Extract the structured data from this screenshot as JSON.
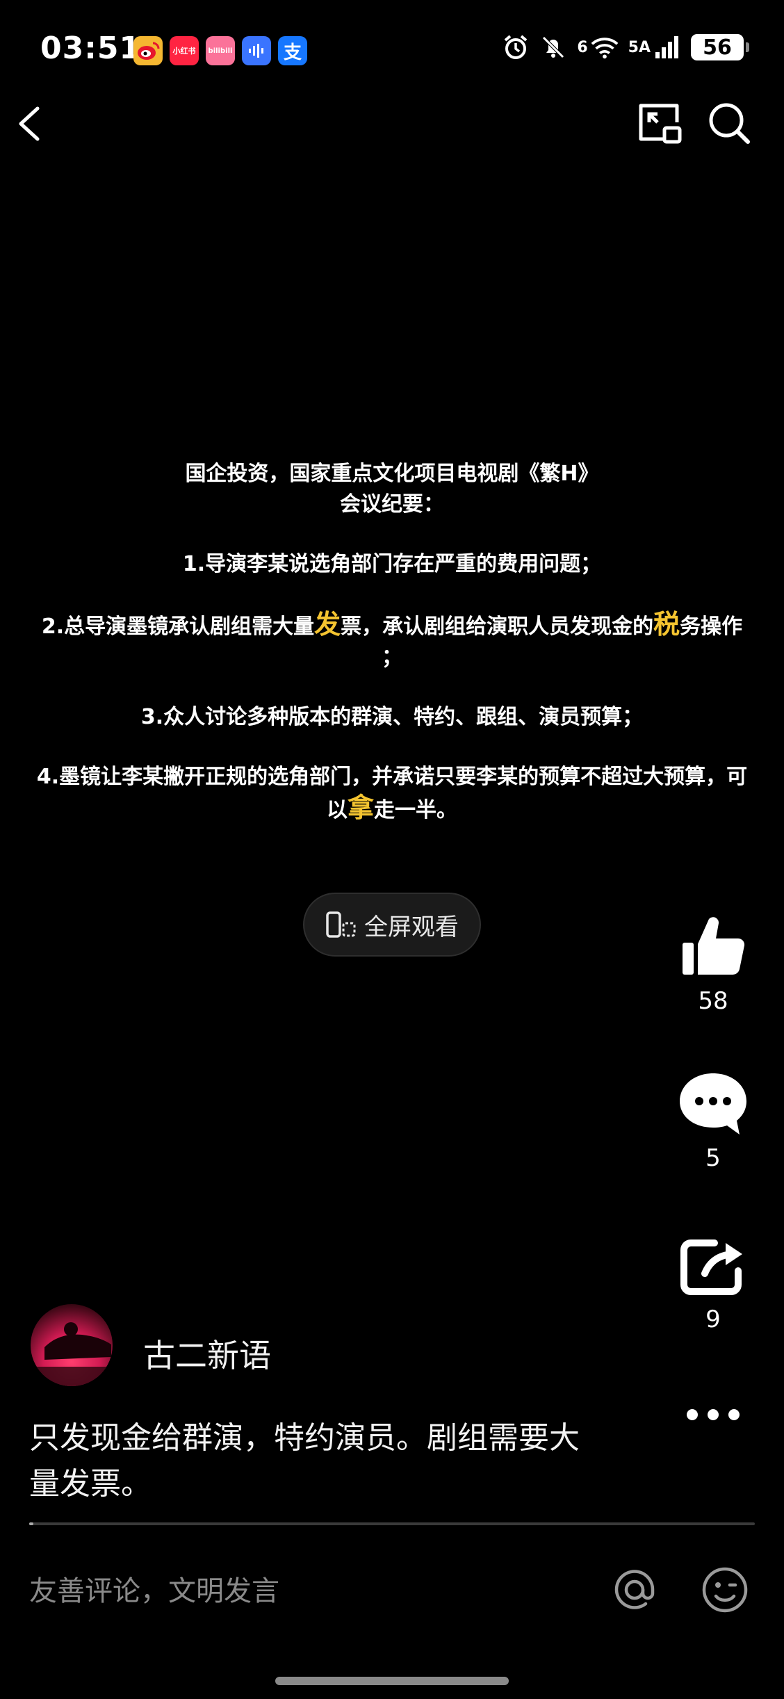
{
  "status_bar": {
    "time": "03:51",
    "apps": [
      {
        "name": "weibo-icon",
        "label": "",
        "color": "#f5b731"
      },
      {
        "name": "xiaohongshu-icon",
        "label": "小红书",
        "color": "#ff2442"
      },
      {
        "name": "bilibili-icon",
        "label": "bilibili",
        "color": "#fb7299"
      },
      {
        "name": "voice-app-icon",
        "label": "",
        "color": "#3a74ff"
      },
      {
        "name": "alipay-icon",
        "label": "支",
        "color": "#1677ff"
      }
    ],
    "net_label_1": "6",
    "net_label_2": "5A",
    "battery": "56"
  },
  "video": {
    "title_line1": "国企投资，国家重点文化项目电视剧《繁H》",
    "title_line2": "会议纪要：",
    "point1": "1.导演李某说选角部门存在严重的费用问题；",
    "point2_a": "2.总导演墨镜承认剧组需大量",
    "point2_h1": "发",
    "point2_b": "票，承认剧组给演职人员发现金的",
    "point2_h2": "税",
    "point2_c": "务操作",
    "point2_end": "；",
    "point3": "3.众人讨论多种版本的群演、特约、跟组、演员预算；",
    "point4_line1": "4.墨镜让李某撇开正规的选角部门，并承诺只要李某的预算不超过大预算，可",
    "point4_a": "以",
    "point4_h": "拿",
    "point4_b": "走一半。",
    "highlight_color": "#f4c430"
  },
  "fullscreen_label": "全屏观看",
  "actions": {
    "like_count": "58",
    "comment_count": "5",
    "share_count": "9"
  },
  "author": {
    "name": "古二新语"
  },
  "caption_line1": "只发现金给群演，特约演员。剧组需要大",
  "caption_line2": "量发票。",
  "progress": 0.004,
  "comment_bar": {
    "placeholder": "友善评论，文明发言"
  }
}
